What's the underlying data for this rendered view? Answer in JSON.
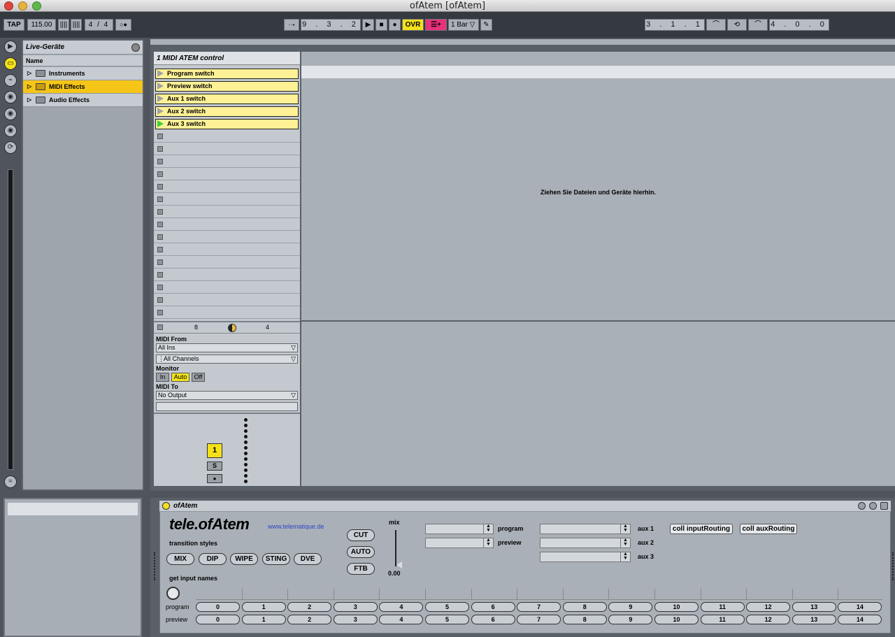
{
  "window": {
    "title": "ofAtem  [ofAtem]"
  },
  "controlbar": {
    "tap": "TAP",
    "tempo": "115.00",
    "meter": "4 / 4",
    "position": "9 . 3 . 2",
    "ovr": "OVR",
    "quantize": "1 Bar",
    "loop_start": "3 . 1 . 1",
    "loop_length": "4 . 0 . 0"
  },
  "browser": {
    "title": "Live-Geräte",
    "col_header": "Name",
    "items": [
      {
        "label": "Instruments",
        "selected": false
      },
      {
        "label": "MIDI Effects",
        "selected": true
      },
      {
        "label": "Audio Effects",
        "selected": false
      }
    ]
  },
  "track": {
    "name": "1 MIDI ATEM control",
    "clips": [
      "Program switch",
      "Preview switch",
      "Aux 1 switch",
      "Aux 2 switch",
      "Aux 3 switch"
    ],
    "footer_left": "8",
    "footer_right": "4",
    "midi_from_label": "MIDI From",
    "midi_from": "All Ins",
    "channel": "All Channels",
    "monitor_label": "Monitor",
    "monitor_in": "In",
    "monitor_auto": "Auto",
    "monitor_off": "Off",
    "midi_to_label": "MIDI To",
    "midi_to": "No Output",
    "track_num": "1",
    "solo": "S"
  },
  "dropzone": {
    "hint": "Ziehen Sie Dateien und Geräte hierhin."
  },
  "device": {
    "name": "ofAtem",
    "brand": "tele.ofAtem",
    "url": "www.telematique.de",
    "transition_label": "transition styles",
    "transitions": [
      "MIX",
      "DIP",
      "WIPE",
      "STING",
      "DVE"
    ],
    "get_names": "get input names",
    "actions": [
      "CUT",
      "AUTO",
      "FTB"
    ],
    "mix_label": "mix",
    "mix_value": "0.00",
    "program_label": "program",
    "preview_label": "preview",
    "aux1": "aux 1",
    "aux2": "aux 2",
    "aux3": "aux 3",
    "route_input": "coll inputRouting",
    "route_aux": "coll auxRouting",
    "inputs": [
      "0",
      "1",
      "2",
      "3",
      "4",
      "5",
      "6",
      "7",
      "8",
      "9",
      "10",
      "11",
      "12",
      "13",
      "14"
    ]
  }
}
